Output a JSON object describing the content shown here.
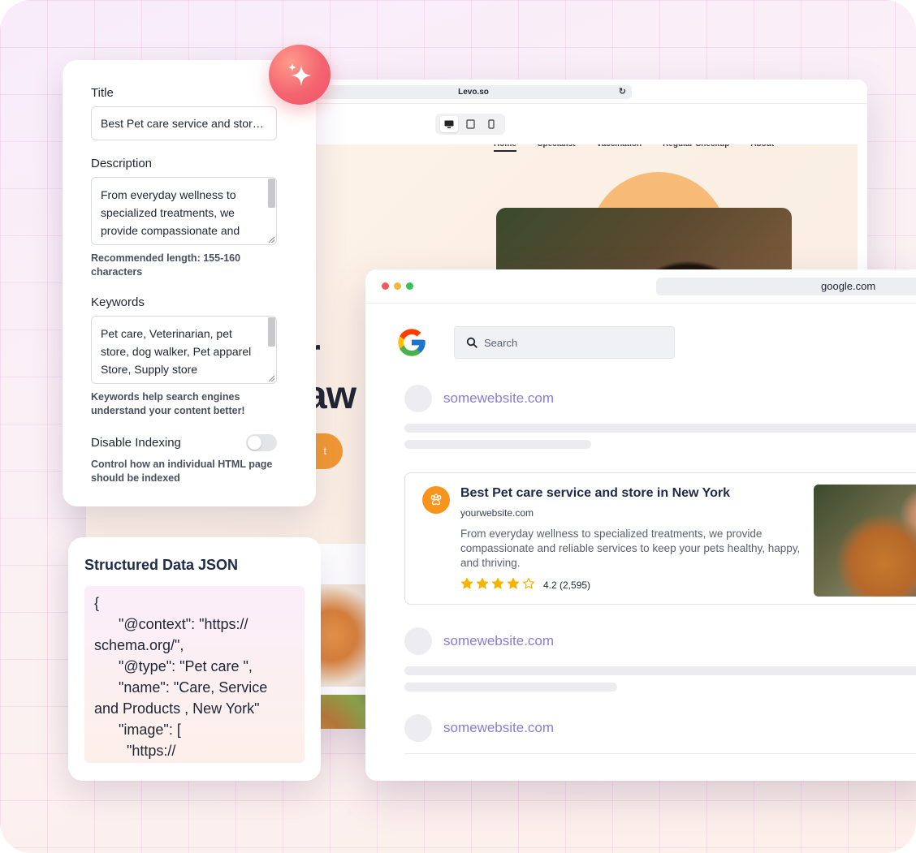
{
  "back_browser": {
    "url": "Levo.so",
    "nav": [
      "Home",
      "Specialist",
      "Vaccination",
      "Regular Checkup",
      "About"
    ],
    "hero_partial_1": "r",
    "hero_partial_2": "aw",
    "cta_partial": "t"
  },
  "seo_panel": {
    "title_label": "Title",
    "title_value": "Best Pet care service and store in New York",
    "description_label": "Description",
    "description_value": "From everyday wellness to specialized treatments, we provide compassionate and reliable services to keep your pets healthy, happy, and thriving.",
    "description_helper": "Recommended length: 155-160 characters",
    "keywords_label": "Keywords",
    "keywords_value": "Pet care, Veterinarian, pet store, dog walker, Pet apparel Store, Supply store",
    "keywords_helper": "Keywords help search engines understand your content better!",
    "indexing_label": "Disable Indexing",
    "indexing_enabled": false,
    "indexing_helper": "Control how an individual HTML page should be indexed"
  },
  "structured_data": {
    "title": "Structured Data JSON",
    "json_text": "{\n      \"@context\": \"https://\nschema.org/\",\n      \"@type\": \"Pet care \",\n      \"name\": \"Care, Service\nand Products , New York\"\n      \"image\": [\n        \"https://"
  },
  "google_browser": {
    "url": "google.com",
    "search_placeholder": "Search",
    "results": [
      {
        "domain": "somewebsite.com"
      },
      {
        "domain": "somewebsite.com"
      },
      {
        "domain": "somewebsite.com"
      }
    ],
    "featured": {
      "title": "Best Pet care service and store in New York",
      "url": "yourwebsite.com",
      "description": "From everyday wellness to specialized treatments, we provide compassionate and reliable services to keep your pets healthy, happy, and thriving.",
      "rating": 4.2,
      "rating_text": "4.2 (2,595)",
      "stars_filled": 4,
      "stars_total": 5
    }
  },
  "colors": {
    "accent_orange": "#f7941e",
    "link_purple": "#8a7bd8",
    "star_yellow": "#f6b400",
    "sparkle_red": "#f46470"
  }
}
